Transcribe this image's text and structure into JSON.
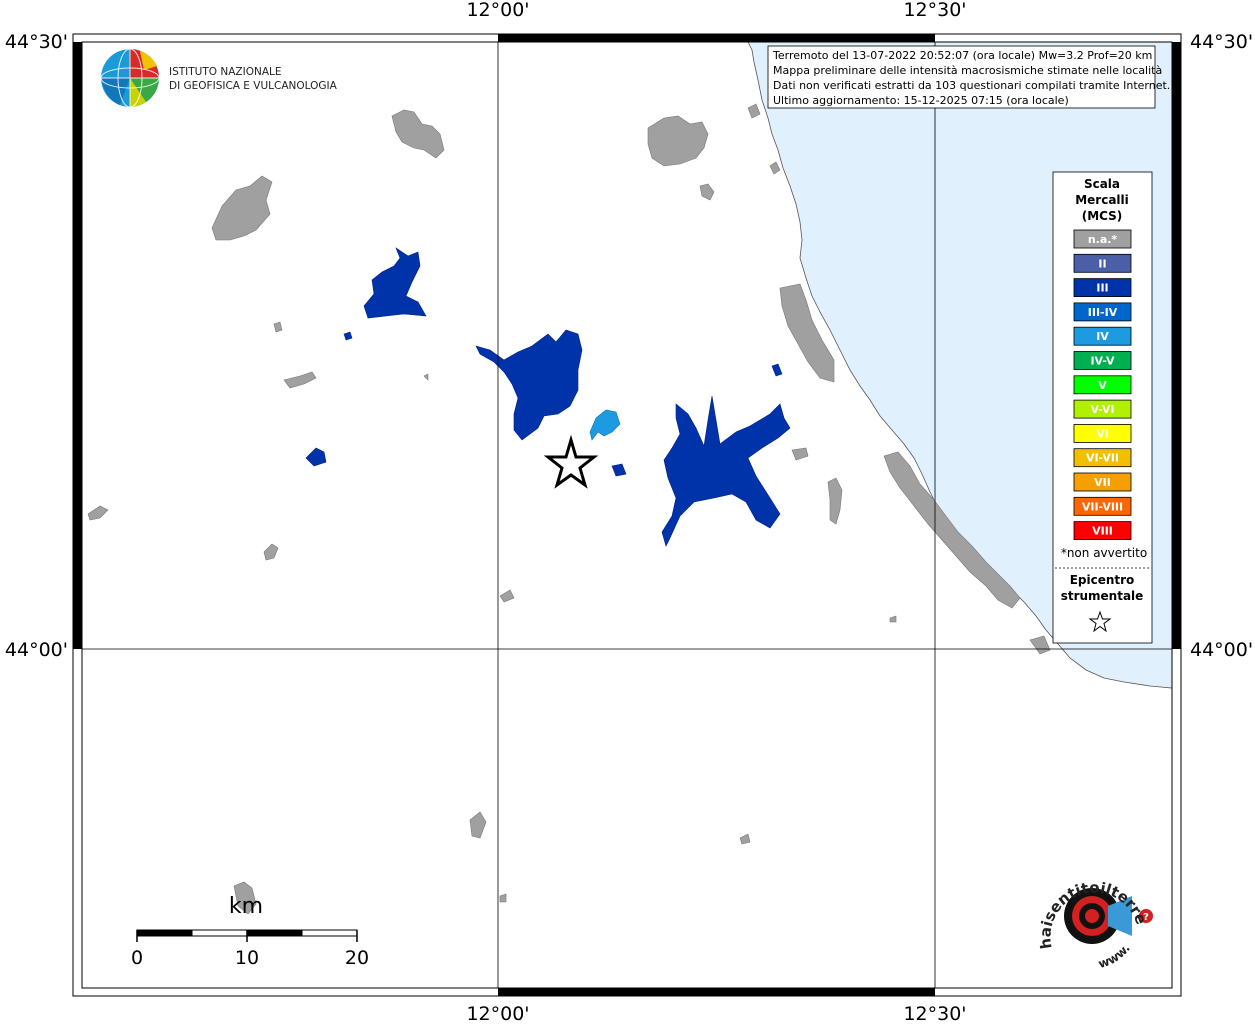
{
  "map": {
    "lat_labels": {
      "top": "44°30'",
      "bottom": "44°00'"
    },
    "lon_labels": {
      "left": "12°00'",
      "right": "12°30'"
    }
  },
  "info_box": {
    "lines": [
      "Terremoto del 13-07-2022 20:52:07 (ora locale) Mw=3.2 Prof=20 km",
      "Mappa preliminare delle intensità macrosismiche stimate nelle località",
      "Dati non verificati estratti da 103 questionari compilati tramite Internet.",
      "Ultimo aggiornamento: 15-12-2025 07:15 (ora locale)"
    ]
  },
  "logo_ingv": {
    "line1": "ISTITUTO NAZIONALE",
    "line2": "DI GEOFISICA E VULCANOLOGIA"
  },
  "legend": {
    "title": [
      "Scala",
      "Mercalli",
      "(MCS)"
    ],
    "items": [
      {
        "label": "n.a.*",
        "color": "#a0a0a0"
      },
      {
        "label": "II",
        "color": "#4a5fa8"
      },
      {
        "label": "III",
        "color": "#0033aa"
      },
      {
        "label": "III-IV",
        "color": "#0066cc"
      },
      {
        "label": "IV",
        "color": "#1e9be0"
      },
      {
        "label": "IV-V",
        "color": "#00b050"
      },
      {
        "label": "V",
        "color": "#00ff00"
      },
      {
        "label": "V-VI",
        "color": "#b0f000"
      },
      {
        "label": "VI",
        "color": "#ffff00"
      },
      {
        "label": "VI-VII",
        "color": "#f0c000"
      },
      {
        "label": "VII",
        "color": "#f5a000"
      },
      {
        "label": "VII-VIII",
        "color": "#ff6600"
      },
      {
        "label": "VIII",
        "color": "#ff0000"
      }
    ],
    "note": "*non avvertito",
    "epicenter_title": [
      "Epicentro",
      "strumentale"
    ]
  },
  "scale_bar": {
    "unit": "km",
    "labels": [
      "0",
      "10",
      "20"
    ]
  },
  "logo_hsit": {
    "text": "haisentitoilterremoto.it",
    "www": "www."
  },
  "colors": {
    "sea": "#e0f0fc",
    "land_na": "#a0a0a0",
    "intensity_iii": "#0033aa",
    "intensity_iv": "#1e9be0"
  }
}
